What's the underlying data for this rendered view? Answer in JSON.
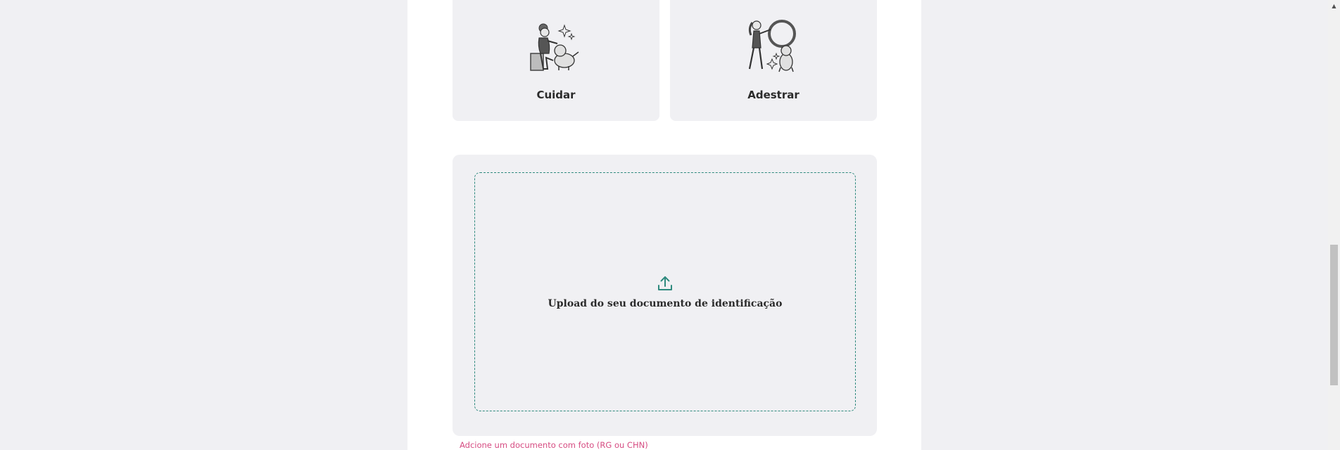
{
  "services": [
    {
      "label": "Cuidar",
      "icon": "person-petting-dog-illustration"
    },
    {
      "label": "Adestrar",
      "icon": "person-training-dog-with-hoop-illustration"
    }
  ],
  "upload": {
    "label": "Upload do seu documento de identificação",
    "icon": "upload-icon",
    "helper_text": "Adcione um documento com foto (RG ou CHN)"
  },
  "colors": {
    "background": "#f0f0f3",
    "card": "#f0f0f3",
    "accent": "#2f8a7e",
    "helper": "#d64c82",
    "text": "#2b2b2b"
  },
  "scrollbar": {
    "up_arrow": "▲"
  }
}
